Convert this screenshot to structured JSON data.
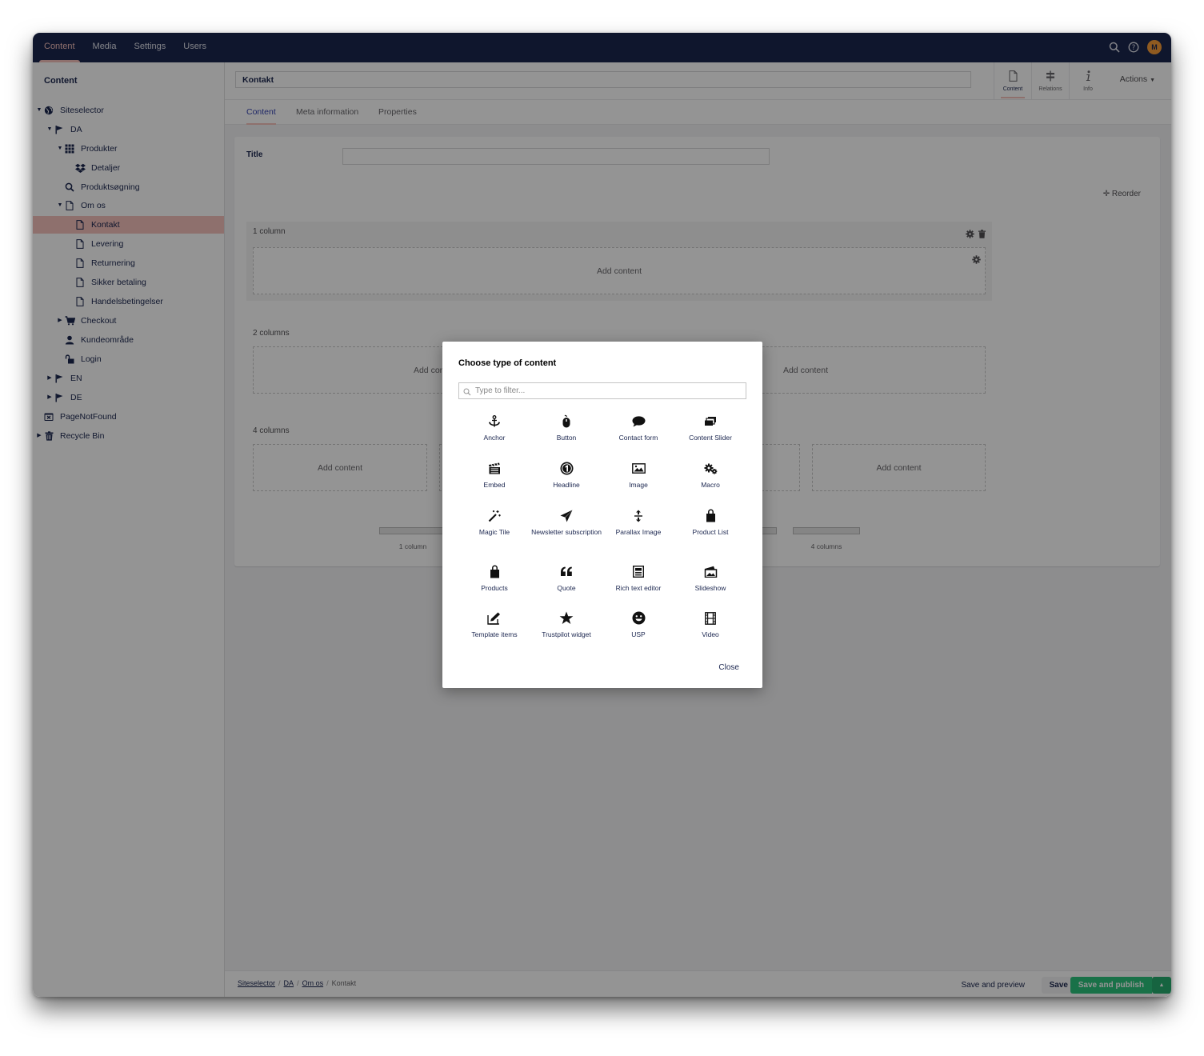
{
  "topnav": {
    "items": [
      "Content",
      "Media",
      "Settings",
      "Users"
    ],
    "active": "Content",
    "avatar_initial": "M"
  },
  "tree": {
    "title": "Content",
    "nodes": [
      {
        "label": "Siteselector",
        "icon": "globe-icon"
      },
      {
        "label": "DA",
        "icon": "flag-icon"
      },
      {
        "label": "Produkter",
        "icon": "grid-icon"
      },
      {
        "label": "Detaljer",
        "icon": "dropbox-icon"
      },
      {
        "label": "Produktsøgning",
        "icon": "search-icon"
      },
      {
        "label": "Om os",
        "icon": "document-icon"
      },
      {
        "label": "Kontakt",
        "icon": "document-icon"
      },
      {
        "label": "Levering",
        "icon": "document-icon"
      },
      {
        "label": "Returnering",
        "icon": "document-icon"
      },
      {
        "label": "Sikker betaling",
        "icon": "document-icon"
      },
      {
        "label": "Handelsbetingelser",
        "icon": "document-icon"
      },
      {
        "label": "Checkout",
        "icon": "cart-icon"
      },
      {
        "label": "Kundeområde",
        "icon": "user-icon"
      },
      {
        "label": "Login",
        "icon": "unlock-icon"
      },
      {
        "label": "EN",
        "icon": "flag-icon"
      },
      {
        "label": "DE",
        "icon": "flag-icon"
      },
      {
        "label": "PageNotFound",
        "icon": "not-found-icon"
      },
      {
        "label": "Recycle Bin",
        "icon": "trash-icon"
      }
    ]
  },
  "editor": {
    "page_name": "Kontakt",
    "apps": [
      {
        "label": "Content",
        "icon": "document-icon"
      },
      {
        "label": "Relations",
        "icon": "signpost-icon"
      },
      {
        "label": "Info",
        "icon": "info-icon"
      }
    ],
    "actions_label": "Actions",
    "tabs": [
      "Content",
      "Meta information",
      "Properties"
    ],
    "title_label": "Title",
    "reorder_label": "Reorder",
    "rows": [
      {
        "title": "1 column",
        "cell_label": "Add content"
      },
      {
        "title": "2 columns",
        "cell_label": "Add content"
      },
      {
        "title": "4 columns",
        "cell_label": "Add content"
      }
    ],
    "layout_options": [
      "1 column",
      "4 columns"
    ]
  },
  "footer": {
    "breadcrumb": [
      "Siteselector",
      "DA",
      "Om os",
      "Kontakt"
    ],
    "save_preview": "Save and preview",
    "save": "Save",
    "save_publish": "Save and publish"
  },
  "modal": {
    "title": "Choose type of content",
    "filter_placeholder": "Type to filter...",
    "items": [
      {
        "label": "Anchor",
        "icon": "anchor-icon"
      },
      {
        "label": "Button",
        "icon": "mouse-icon"
      },
      {
        "label": "Contact form",
        "icon": "chat-icon"
      },
      {
        "label": "Content Slider",
        "icon": "slider-icon"
      },
      {
        "label": "Embed",
        "icon": "clapperboard-icon"
      },
      {
        "label": "Headline",
        "icon": "number-one-icon"
      },
      {
        "label": "Image",
        "icon": "picture-icon"
      },
      {
        "label": "Macro",
        "icon": "gears-icon"
      },
      {
        "label": "Magic Tile",
        "icon": "magic-wand-icon"
      },
      {
        "label": "Newsletter subscription",
        "icon": "paper-plane-icon"
      },
      {
        "label": "Parallax Image",
        "icon": "vertical-arrows-icon"
      },
      {
        "label": "Product List",
        "icon": "shopping-bag-icon"
      },
      {
        "label": "Products",
        "icon": "shopping-bag-icon"
      },
      {
        "label": "Quote",
        "icon": "quote-icon"
      },
      {
        "label": "Rich text editor",
        "icon": "newspaper-icon"
      },
      {
        "label": "Slideshow",
        "icon": "photos-icon"
      },
      {
        "label": "Template items",
        "icon": "edit-icon"
      },
      {
        "label": "Trustpilot widget",
        "icon": "star-icon"
      },
      {
        "label": "USP",
        "icon": "smiley-icon"
      },
      {
        "label": "Video",
        "icon": "film-icon"
      }
    ],
    "close_label": "Close"
  },
  "colors": {
    "topbar": "#1b264f",
    "accent": "#f5c1bc",
    "publish": "#2bc37c",
    "overlay": "rgba(0,0,0,0.42)"
  }
}
